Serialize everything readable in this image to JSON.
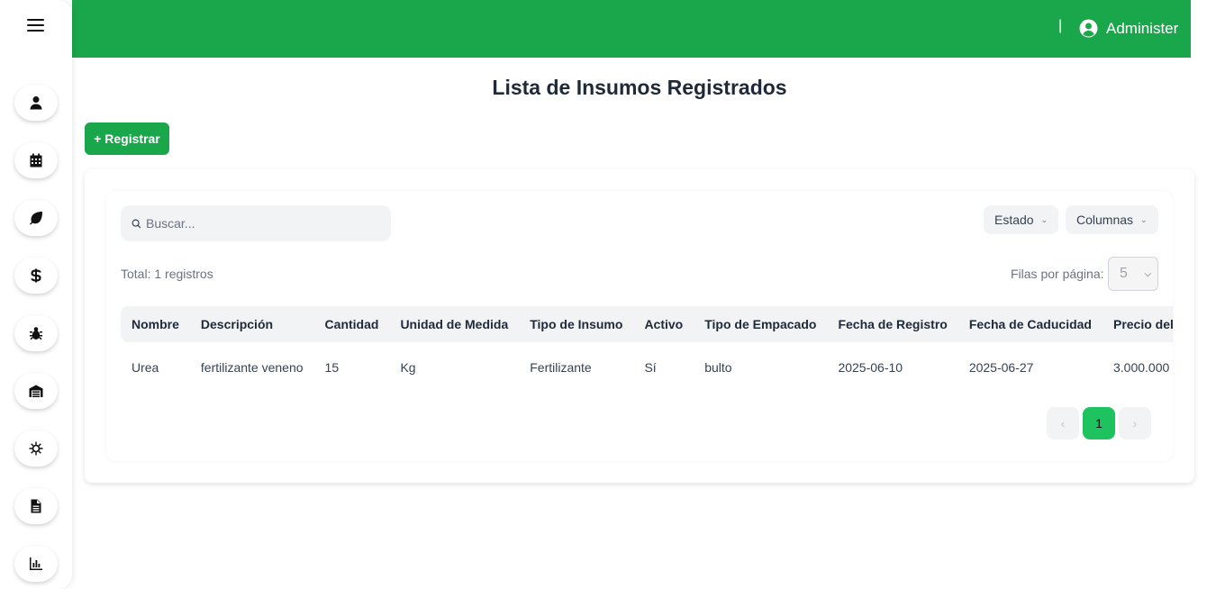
{
  "header": {
    "separator": "|",
    "user_name": "Administer"
  },
  "sidebar": {
    "items": [
      {
        "icon": "user-icon"
      },
      {
        "icon": "calendar-icon"
      },
      {
        "icon": "leaf-icon"
      },
      {
        "icon": "dollar-icon"
      },
      {
        "icon": "bug-icon"
      },
      {
        "icon": "warehouse-icon"
      },
      {
        "icon": "virus-icon"
      },
      {
        "icon": "document-icon"
      },
      {
        "icon": "chart-icon"
      }
    ]
  },
  "main": {
    "title": "Lista de Insumos Registrados",
    "register_label": "+ Registrar",
    "search_placeholder": "Buscar...",
    "estado_label": "Estado",
    "columnas_label": "Columnas",
    "total_text": "Total: 1 registros",
    "filas_label": "Filas por página:",
    "filas_value": "5",
    "columns": [
      "Nombre",
      "Descripción",
      "Cantidad",
      "Unidad de Medida",
      "Tipo de Insumo",
      "Activo",
      "Tipo de Empacado",
      "Fecha de Registro",
      "Fecha de Caducidad",
      "Precio del Insumo"
    ],
    "rows": [
      [
        "Urea",
        "fertilizante veneno",
        "15",
        "Kg",
        "Fertilizante",
        "Sí",
        "bulto",
        "2025-06-10",
        "2025-06-27",
        "3.000.000"
      ]
    ],
    "pagination": {
      "prev": "‹",
      "current": "1",
      "next": "›"
    }
  },
  "colors": {
    "brand_green": "#1aa64b",
    "active_page": "#1ec25e"
  }
}
